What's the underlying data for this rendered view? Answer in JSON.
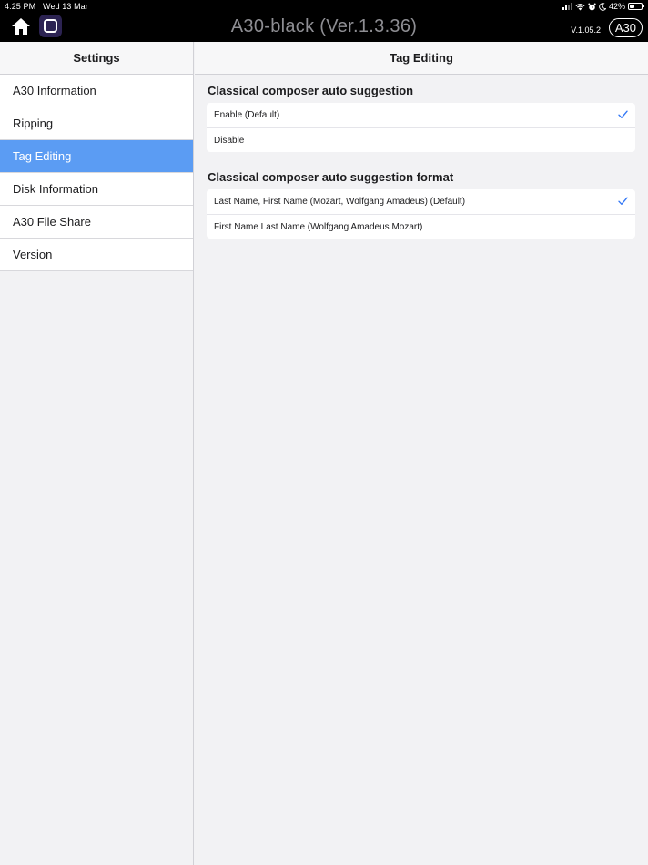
{
  "status_bar": {
    "time": "4:25 PM",
    "date": "Wed 13 Mar",
    "battery_percent": "42%",
    "battery_level": 0.42
  },
  "header": {
    "app_title": "A30-black (Ver.1.3.36)",
    "app_version": "V.1.05.2",
    "device_badge": "A30"
  },
  "sidebar": {
    "title": "Settings",
    "items": [
      {
        "label": "A30 Information",
        "active": false
      },
      {
        "label": "Ripping",
        "active": false
      },
      {
        "label": "Tag Editing",
        "active": true
      },
      {
        "label": "Disk Information",
        "active": false
      },
      {
        "label": "A30 File Share",
        "active": false
      },
      {
        "label": "Version",
        "active": false
      }
    ]
  },
  "main": {
    "title": "Tag Editing",
    "sections": [
      {
        "title": "Classical composer auto suggestion",
        "options": [
          {
            "label": "Enable (Default)",
            "selected": true
          },
          {
            "label": "Disable",
            "selected": false
          }
        ]
      },
      {
        "title": "Classical composer auto suggestion format",
        "options": [
          {
            "label": "Last Name, First Name (Mozart, Wolfgang Amadeus) (Default)",
            "selected": true
          },
          {
            "label": "First Name Last Name (Wolfgang Amadeus Mozart)",
            "selected": false
          }
        ]
      }
    ]
  },
  "colors": {
    "accent": "#5b9cf3",
    "check": "#3478f6",
    "topbar": "#000000"
  }
}
